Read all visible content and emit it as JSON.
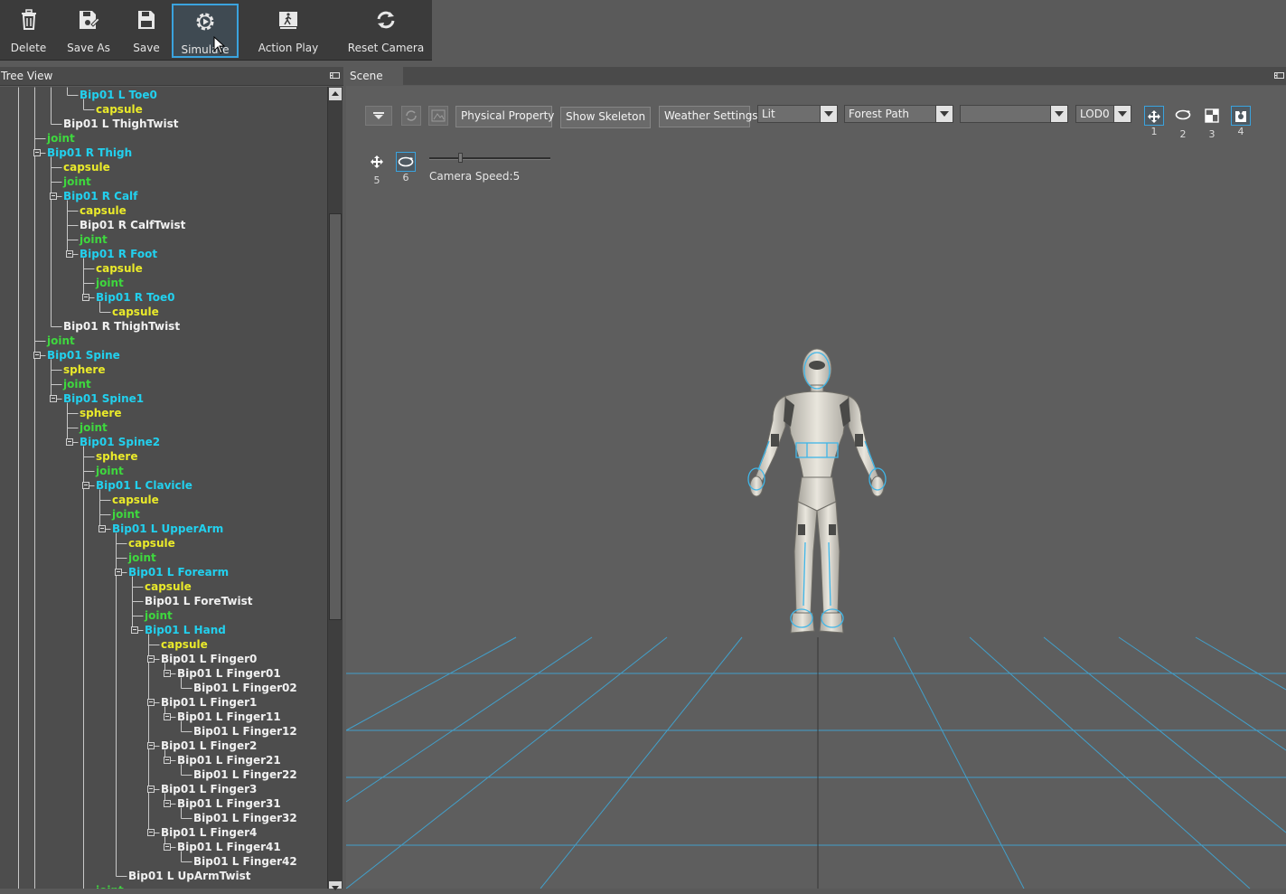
{
  "toolbar": {
    "buttons": [
      {
        "label": "Delete",
        "icon": "trash-icon"
      },
      {
        "label": "Save As",
        "icon": "save-as-icon"
      },
      {
        "label": "Save",
        "icon": "save-icon"
      },
      {
        "label": "Simulate",
        "icon": "gear-play-icon",
        "active": true
      },
      {
        "label": "Action Play",
        "icon": "walking-figure-icon"
      },
      {
        "label": "Reset Camera",
        "icon": "refresh-icon"
      }
    ]
  },
  "tree_view": {
    "title": "Tree View",
    "nodes": [
      {
        "label": "Bip01 L Toe0",
        "kind": "bone"
      },
      {
        "label": "capsule",
        "kind": "shape"
      },
      {
        "label": "Bip01 L ThighTwist",
        "kind": "plain"
      },
      {
        "label": "joint",
        "kind": "joint"
      },
      {
        "label": "Bip01 R Thigh",
        "kind": "bone"
      },
      {
        "label": "capsule",
        "kind": "shape"
      },
      {
        "label": "joint",
        "kind": "joint"
      },
      {
        "label": "Bip01 R Calf",
        "kind": "bone"
      },
      {
        "label": "capsule",
        "kind": "shape"
      },
      {
        "label": "Bip01 R CalfTwist",
        "kind": "plain"
      },
      {
        "label": "joint",
        "kind": "joint"
      },
      {
        "label": "Bip01 R Foot",
        "kind": "bone"
      },
      {
        "label": "capsule",
        "kind": "shape"
      },
      {
        "label": "joint",
        "kind": "joint"
      },
      {
        "label": "Bip01 R Toe0",
        "kind": "bone"
      },
      {
        "label": "capsule",
        "kind": "shape"
      },
      {
        "label": "Bip01 R ThighTwist",
        "kind": "plain"
      },
      {
        "label": "joint",
        "kind": "joint"
      },
      {
        "label": "Bip01 Spine",
        "kind": "bone"
      },
      {
        "label": "sphere",
        "kind": "shape"
      },
      {
        "label": "joint",
        "kind": "joint"
      },
      {
        "label": "Bip01 Spine1",
        "kind": "bone"
      },
      {
        "label": "sphere",
        "kind": "shape"
      },
      {
        "label": "joint",
        "kind": "joint"
      },
      {
        "label": "Bip01 Spine2",
        "kind": "bone"
      },
      {
        "label": "sphere",
        "kind": "shape"
      },
      {
        "label": "joint",
        "kind": "joint"
      },
      {
        "label": "Bip01 L Clavicle",
        "kind": "bone"
      },
      {
        "label": "capsule",
        "kind": "shape"
      },
      {
        "label": "joint",
        "kind": "joint"
      },
      {
        "label": "Bip01 L UpperArm",
        "kind": "bone"
      },
      {
        "label": "capsule",
        "kind": "shape"
      },
      {
        "label": "joint",
        "kind": "joint"
      },
      {
        "label": "Bip01 L Forearm",
        "kind": "bone"
      },
      {
        "label": "capsule",
        "kind": "shape"
      },
      {
        "label": "Bip01 L ForeTwist",
        "kind": "plain"
      },
      {
        "label": "joint",
        "kind": "joint"
      },
      {
        "label": "Bip01 L Hand",
        "kind": "bone"
      },
      {
        "label": "capsule",
        "kind": "shape"
      },
      {
        "label": "Bip01 L Finger0",
        "kind": "plain"
      },
      {
        "label": "Bip01 L Finger01",
        "kind": "plain"
      },
      {
        "label": "Bip01 L Finger02",
        "kind": "plain"
      },
      {
        "label": "Bip01 L Finger1",
        "kind": "plain"
      },
      {
        "label": "Bip01 L Finger11",
        "kind": "plain"
      },
      {
        "label": "Bip01 L Finger12",
        "kind": "plain"
      },
      {
        "label": "Bip01 L Finger2",
        "kind": "plain"
      },
      {
        "label": "Bip01 L Finger21",
        "kind": "plain"
      },
      {
        "label": "Bip01 L Finger22",
        "kind": "plain"
      },
      {
        "label": "Bip01 L Finger3",
        "kind": "plain"
      },
      {
        "label": "Bip01 L Finger31",
        "kind": "plain"
      },
      {
        "label": "Bip01 L Finger32",
        "kind": "plain"
      },
      {
        "label": "Bip01 L Finger4",
        "kind": "plain"
      },
      {
        "label": "Bip01 L Finger41",
        "kind": "plain"
      },
      {
        "label": "Bip01 L Finger42",
        "kind": "plain"
      },
      {
        "label": "Bip01 L UpArmTwist",
        "kind": "plain"
      },
      {
        "label": "joint",
        "kind": "joint"
      }
    ],
    "colors": {
      "bone": "#22d0ee",
      "shape": "#eaea2a",
      "joint": "#3ed83e",
      "plain": "#f0f0f0"
    }
  },
  "scene": {
    "tab_label": "Scene",
    "physical_property_label": "Physical Property",
    "show_skeleton_label": "Show Skeleton",
    "weather_settings_label": "Weather Settings",
    "shading_combo": "Lit",
    "environment_combo": "Forest Path",
    "empty_combo": "",
    "lod_combo": "LOD0",
    "modes": [
      {
        "num": "1",
        "icon": "move-icon",
        "selected": true
      },
      {
        "num": "2",
        "icon": "orbit-icon",
        "selected": false
      },
      {
        "num": "3",
        "icon": "scale-icon",
        "selected": false
      },
      {
        "num": "4",
        "icon": "camera-shot-icon",
        "selected": true
      },
      {
        "num": "5",
        "icon": "pan-icon",
        "selected": false
      },
      {
        "num": "6",
        "icon": "rotate-orbit-icon",
        "selected": true
      }
    ],
    "camera_speed_label": "Camera Speed:5",
    "camera_speed_value": 5,
    "grid_color": "#3fa7d6"
  }
}
